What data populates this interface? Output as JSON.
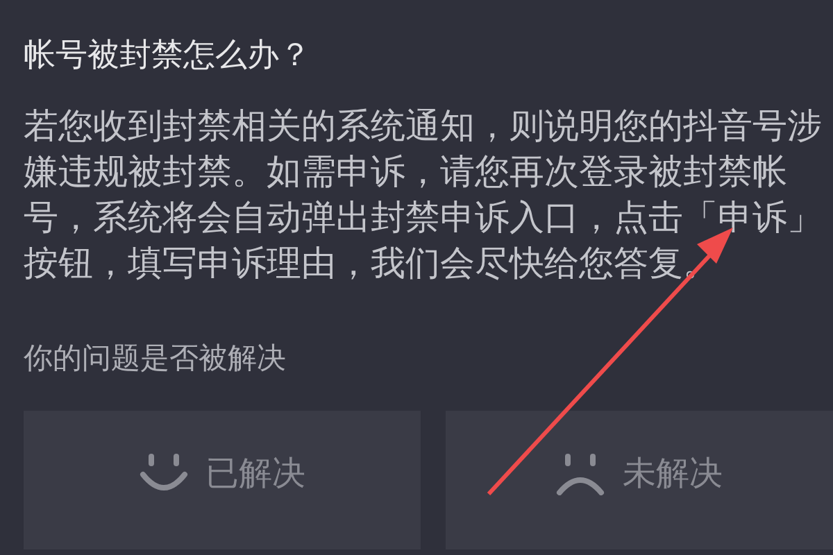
{
  "title": "帐号被封禁怎么办？",
  "body": "若您收到封禁相关的系统通知，则说明您的抖音号涉嫌违规被封禁。如需申诉，请您再次登录被封禁帐号，系统将会自动弹出封禁申诉入口，点击「申诉」按钮，填写申诉理由，我们会尽快给您答复。",
  "feedback": {
    "question": "你的问题是否被解决",
    "options": [
      {
        "kind": "smile",
        "label": "已解决"
      },
      {
        "kind": "frown",
        "label": "未解决"
      }
    ]
  }
}
